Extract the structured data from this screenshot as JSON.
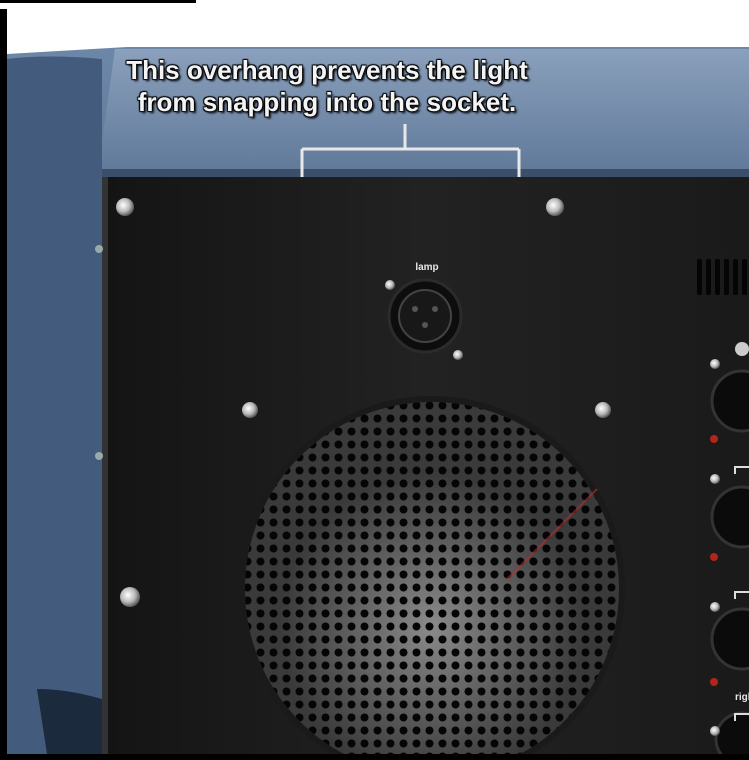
{
  "caption": {
    "line1": "This overhang prevents the light",
    "line2": "from snapping into the socket."
  },
  "connector_labels": {
    "lamp": "lamp",
    "right": "righ"
  },
  "colors": {
    "housing_blue": "#4d6789",
    "panel_black": "#1c1c1c",
    "caption_text": "#f4f4f4",
    "indicator_red": "#b0261a"
  }
}
